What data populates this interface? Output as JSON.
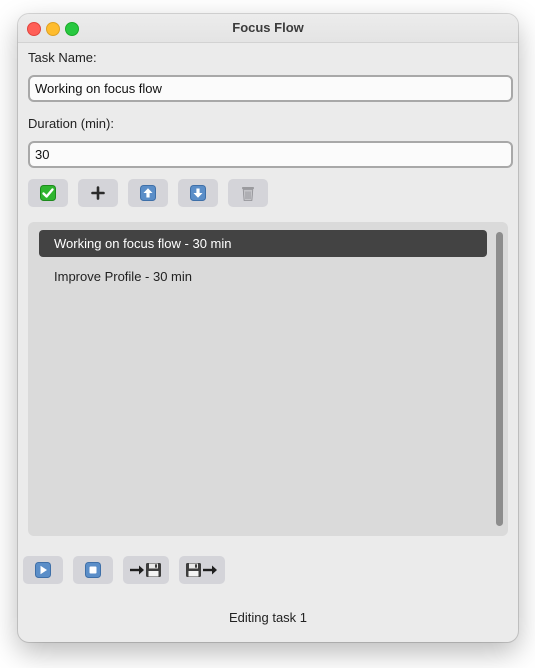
{
  "window": {
    "title": "Focus Flow"
  },
  "form": {
    "task_label": "Task Name:",
    "task_value": "Working on focus flow",
    "duration_label": "Duration (min):",
    "duration_value": "30"
  },
  "toolbar": {
    "buttons": [
      {
        "name": "save-task-button",
        "icon": "check-mark-icon"
      },
      {
        "name": "add-task-button",
        "icon": "plus-icon"
      },
      {
        "name": "move-up-button",
        "icon": "up-arrow-icon"
      },
      {
        "name": "move-down-button",
        "icon": "down-arrow-icon"
      },
      {
        "name": "delete-task-button",
        "icon": "trash-icon"
      }
    ]
  },
  "tasks": [
    {
      "label": "Working on focus flow - 30 min",
      "selected": true
    },
    {
      "label": "Improve Profile - 30 min",
      "selected": false
    }
  ],
  "controls": {
    "buttons": [
      {
        "name": "play-button",
        "icon": "play-icon"
      },
      {
        "name": "stop-button",
        "icon": "stop-icon"
      },
      {
        "name": "import-button",
        "icon": "arrow-to-floppy-icon"
      },
      {
        "name": "export-button",
        "icon": "floppy-to-arrow-icon"
      }
    ]
  },
  "status": {
    "text": "Editing task 1"
  },
  "colors": {
    "selected_row": "#434343",
    "button_bg": "#d4d4d9",
    "check_green": "#2fb52f",
    "icon_blue": "#5b8ec8"
  }
}
